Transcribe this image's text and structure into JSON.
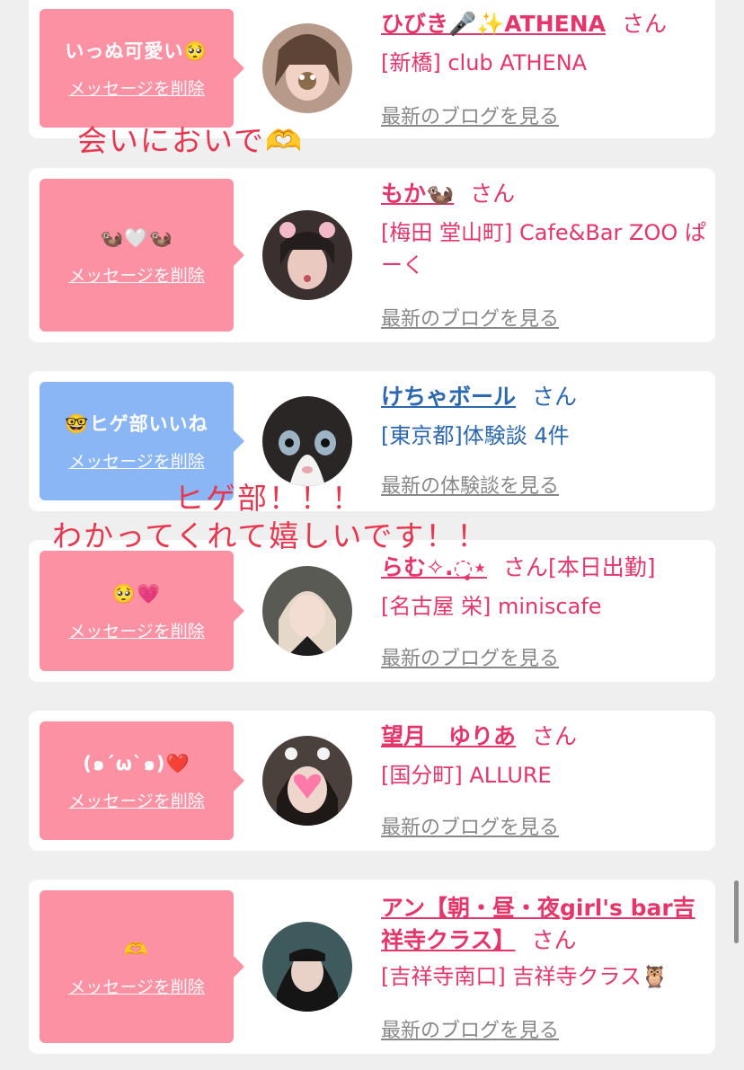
{
  "items": [
    {
      "message": "いっぬ可愛い🥺",
      "delete_label": "メッセージを削除",
      "name": "ひびき🎤✨ATHENA",
      "honorific": "さん",
      "status": "",
      "shop": "[新橋] club ATHENA",
      "link": "最新のブログを見る",
      "theme": "pink"
    },
    {
      "message": "🦦🤍🦦",
      "delete_label": "メッセージを削除",
      "name": "もか🦦",
      "honorific": "さん",
      "status": "",
      "shop": "[梅田 堂山町] Cafe&Bar ZOO ぱーく",
      "link": "最新のブログを見る",
      "theme": "pink"
    },
    {
      "message": "🤓ヒゲ部いいね",
      "delete_label": "メッセージを削除",
      "name": "けちゃボール",
      "honorific": "さん",
      "status": "",
      "shop": "[東京都]体験談 4件",
      "link": "最新の体験談を見る",
      "theme": "blue"
    },
    {
      "message": "🥺💗",
      "delete_label": "メッセージを削除",
      "name": "らむ✧.◌̥‎⋆",
      "honorific": "さん",
      "status": "[本日出勤]",
      "shop": "[名古屋 栄] miniscafe",
      "link": "最新のブログを見る",
      "theme": "pink"
    },
    {
      "message": "(๑´ω`๑)❤️",
      "delete_label": "メッセージを削除",
      "name": "望月　ゆりあ",
      "honorific": "さん",
      "status": "",
      "shop": "[国分町] ALLURE",
      "link": "最新のブログを見る",
      "theme": "pink"
    },
    {
      "message": "🫶",
      "delete_label": "メッセージを削除",
      "name": "アン【朝・昼・夜girl's bar吉祥寺クラス】",
      "honorific": "さん",
      "status": "",
      "shop": "[吉祥寺南口] 吉祥寺クラス🦉",
      "link": "最新のブログを見る",
      "theme": "pink"
    }
  ],
  "overlays": {
    "note1": "会いにおいで🫶",
    "note2": "ヒゲ部！！！",
    "note3": "わかってくれて嬉しいです！！"
  },
  "colors": {
    "accent_pink": "#e6356a",
    "accent_blue": "#2b68b0",
    "bubble_pink": "#fd91a4",
    "bubble_blue": "#8bb6f6",
    "overlay_red": "#e8364f"
  }
}
